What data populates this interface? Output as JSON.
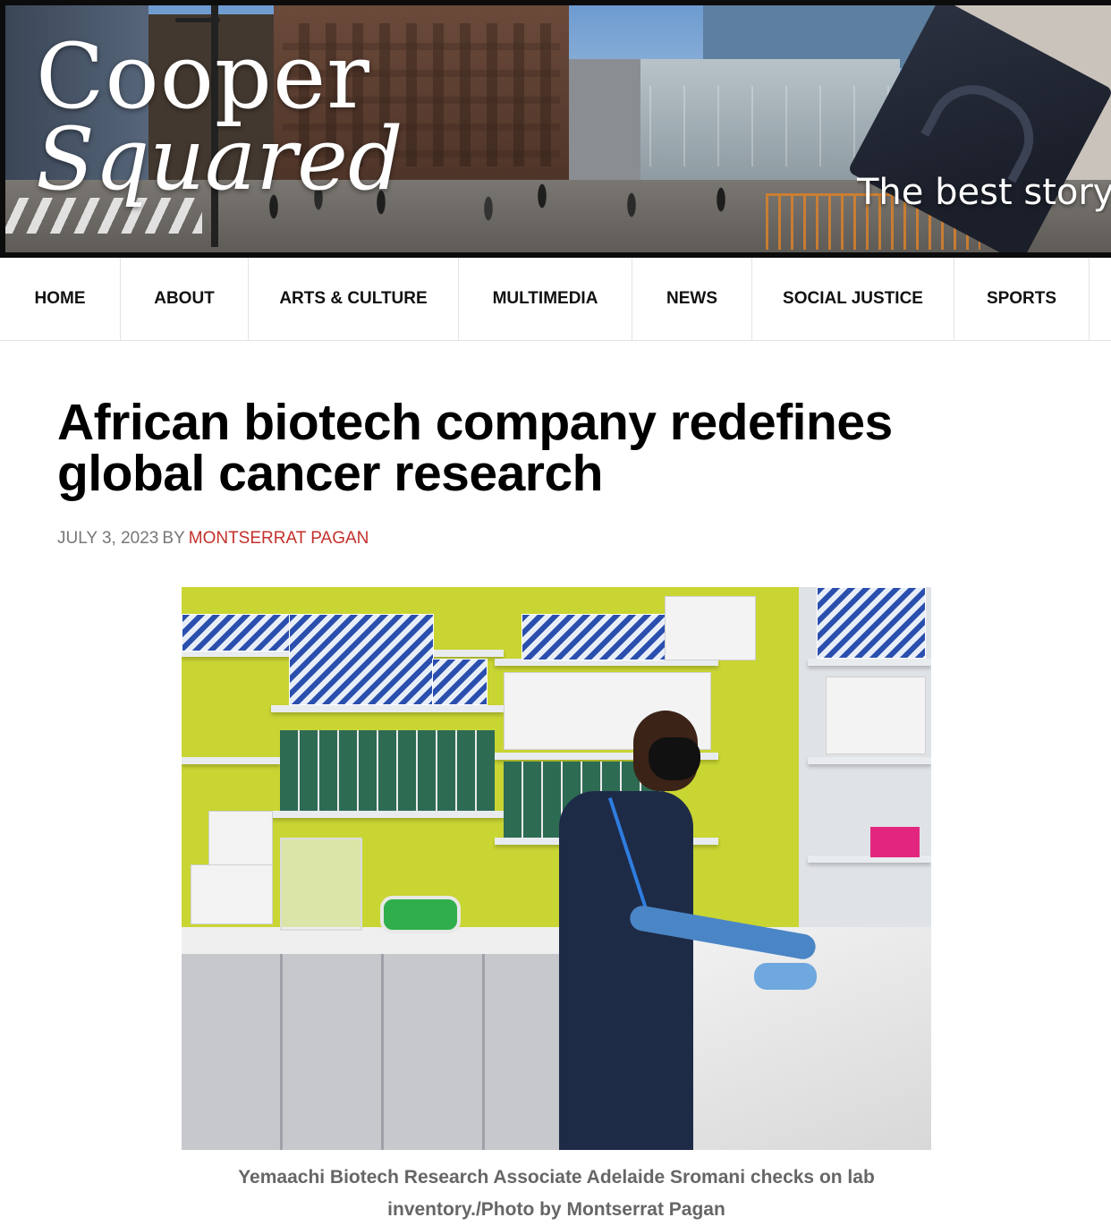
{
  "site": {
    "logo_line1": "Cooper",
    "logo_line2": "Squared",
    "tagline": "The best storyt"
  },
  "nav": {
    "items": [
      {
        "label": "HOME"
      },
      {
        "label": "ABOUT"
      },
      {
        "label": "ARTS & CULTURE"
      },
      {
        "label": "MULTIMEDIA"
      },
      {
        "label": "NEWS"
      },
      {
        "label": "SOCIAL JUSTICE"
      },
      {
        "label": "SPORTS"
      }
    ]
  },
  "article": {
    "title": "African biotech company redefines global cancer research",
    "date": "JULY 3, 2023",
    "by": "BY",
    "author": "MONTSERRAT PAGAN",
    "caption": "Yemaachi Biotech Research Associate Adelaide Sromani checks on lab inventory./Photo by Montserrat Pagan"
  },
  "colors": {
    "author_link": "#c4302b",
    "meta_text": "#777777",
    "caption_text": "#666666",
    "nav_border": "#e3e3e3"
  }
}
